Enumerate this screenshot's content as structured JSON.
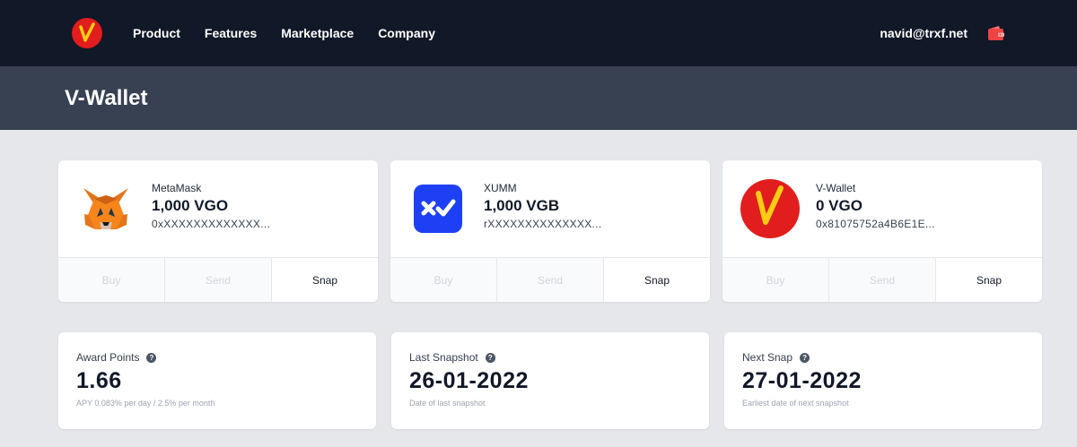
{
  "nav": {
    "links": [
      "Product",
      "Features",
      "Marketplace",
      "Company"
    ],
    "user_email": "navid@trxf.net",
    "logo_icon": "v-logo-icon",
    "wallet_icon": "wallet-icon"
  },
  "page": {
    "title": "V-Wallet"
  },
  "wallets": [
    {
      "name": "MetaMask",
      "balance": "1,000 VGO",
      "address": "0xXXXXXXXXXXXXX...",
      "icon": "metamask-fox-icon",
      "actions": {
        "buy": "Buy",
        "send": "Send",
        "snap": "Snap"
      }
    },
    {
      "name": "XUMM",
      "balance": "1,000 VGB",
      "address": "rXXXXXXXXXXXXXX...",
      "icon": "xumm-icon",
      "actions": {
        "buy": "Buy",
        "send": "Send",
        "snap": "Snap"
      }
    },
    {
      "name": "V-Wallet",
      "balance": "0 VGO",
      "address": "0x81075752a4B6E1E...",
      "icon": "v-wallet-icon",
      "actions": {
        "buy": "Buy",
        "send": "Send",
        "snap": "Snap"
      }
    }
  ],
  "stats": [
    {
      "label": "Award Points",
      "value": "1.66",
      "sub": "APY 0.083% per day / 2.5% per month"
    },
    {
      "label": "Last Snapshot",
      "value": "26-01-2022",
      "sub": "Date of last snapshot"
    },
    {
      "label": "Next Snap",
      "value": "27-01-2022",
      "sub": "Earliest date of next snapshot"
    }
  ],
  "colors": {
    "nav_bg": "#111827",
    "header_bg": "#374151",
    "page_bg": "#e5e7eb",
    "brand_red": "#e11d1d",
    "brand_yellow": "#facc15",
    "xumm_blue": "#1e40f5",
    "metamask_orange": "#e2761b"
  }
}
